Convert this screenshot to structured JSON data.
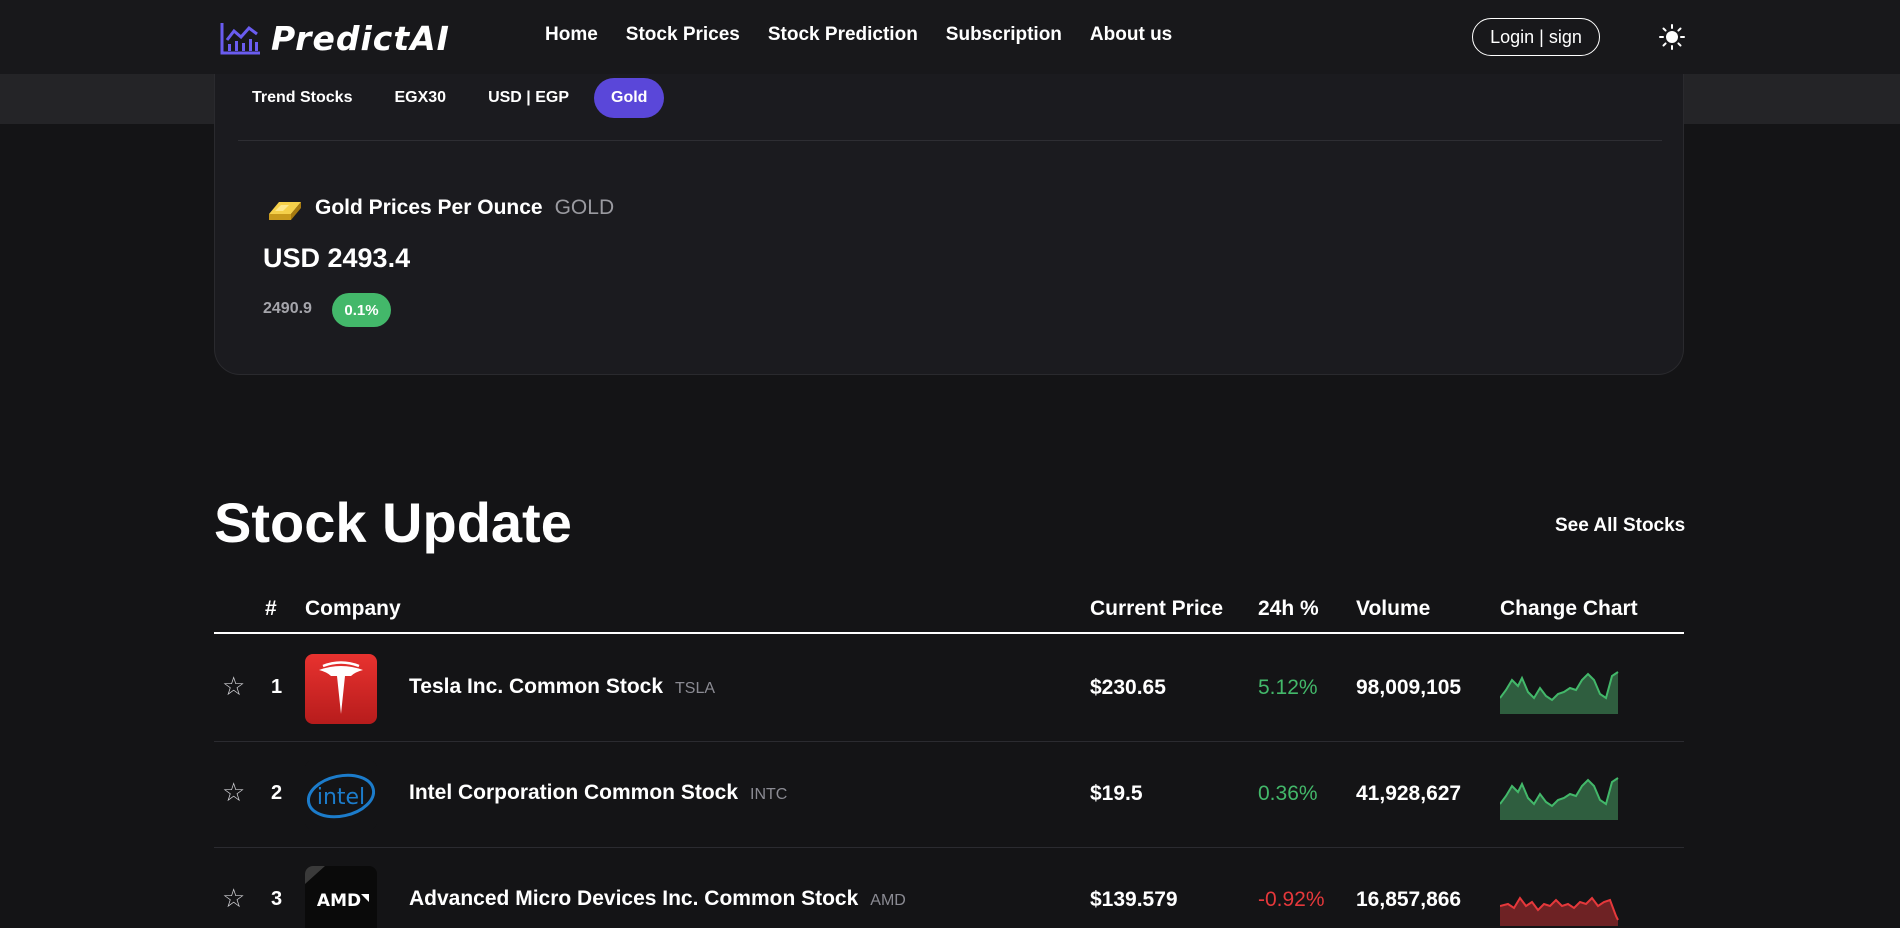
{
  "brand": {
    "name": "PredictAI"
  },
  "nav": [
    {
      "label": "Home"
    },
    {
      "label": "Stock Prices"
    },
    {
      "label": "Stock Prediction"
    },
    {
      "label": "Subscription"
    },
    {
      "label": "About us"
    }
  ],
  "header": {
    "login_label": "Login | sign",
    "theme_icon": "sun-icon"
  },
  "market_tabs": [
    {
      "label": "Trend Stocks",
      "active": false
    },
    {
      "label": "EGX30",
      "active": false
    },
    {
      "label": "USD | EGP",
      "active": false
    },
    {
      "label": "Gold",
      "active": true
    }
  ],
  "gold": {
    "title": "Gold Prices Per Ounce",
    "symbol": "GOLD",
    "price": "USD 2493.4",
    "previous": "2490.9",
    "change": "0.1%",
    "icon": "gold-bar-icon"
  },
  "stock_update": {
    "title": "Stock Update",
    "see_all": "See All Stocks",
    "columns": {
      "rank": "#",
      "company": "Company",
      "price": "Current Price",
      "change": "24h %",
      "volume": "Volume",
      "chart": "Change Chart"
    },
    "rows": [
      {
        "rank": "1",
        "name": "Tesla Inc. Common Stock",
        "ticker": "TSLA",
        "price": "$230.65",
        "change": "5.12%",
        "direction": "up",
        "volume": "98,009,105",
        "logo": "tesla-logo"
      },
      {
        "rank": "2",
        "name": "Intel Corporation Common Stock",
        "ticker": "INTC",
        "price": "$19.5",
        "change": "0.36%",
        "direction": "up",
        "volume": "41,928,627",
        "logo": "intel-logo"
      },
      {
        "rank": "3",
        "name": "Advanced Micro Devices Inc. Common Stock",
        "ticker": "AMD",
        "price": "$139.579",
        "change": "-0.92%",
        "direction": "down",
        "volume": "16,857,866",
        "logo": "amd-logo"
      }
    ]
  },
  "colors": {
    "accent": "#5a47d9",
    "positive": "#43b86a",
    "negative": "#e5383b",
    "background": "#141416"
  }
}
